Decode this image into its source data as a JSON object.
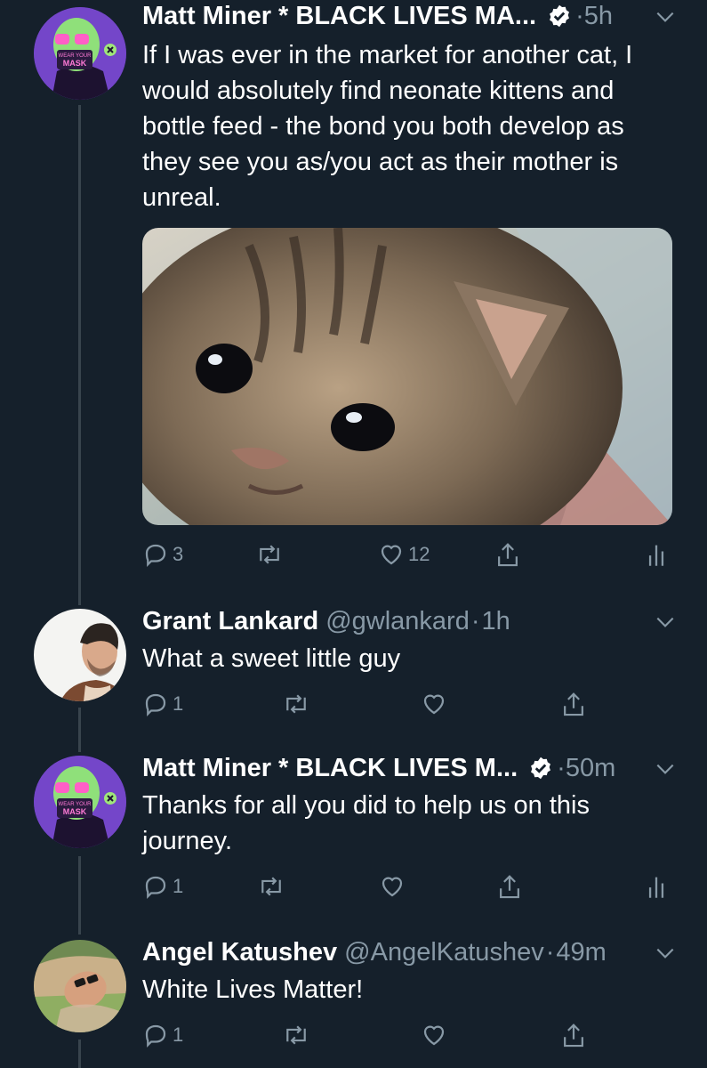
{
  "thread": [
    {
      "name": "Matt Miner * BLACK LIVES MA...",
      "verified": true,
      "dot": "·",
      "time": "5h",
      "text_lines": [
        "If I was ever in the market for another cat, I",
        "would absolutely find neonate kittens and",
        "bottle feed - the bond you both develop as",
        "they see you as/you act as their mother is",
        "unreal."
      ],
      "media_description": "kitten photo",
      "actions": {
        "reply_count": "3",
        "retweet_count": "",
        "like_count": "12"
      }
    },
    {
      "name": "Grant Lankard",
      "handle": "@gwlankard",
      "dot": "·",
      "time": "1h",
      "text_lines": [
        "What a sweet little guy"
      ],
      "actions": {
        "reply_count": "1",
        "retweet_count": "",
        "like_count": ""
      }
    },
    {
      "name": "Matt Miner * BLACK LIVES M...",
      "verified": true,
      "dot": "·",
      "time": "50m",
      "text_lines": [
        "Thanks for all you did to help us on this",
        "journey."
      ],
      "actions": {
        "reply_count": "1",
        "retweet_count": "",
        "like_count": ""
      }
    },
    {
      "name": "Angel Katushev",
      "handle": "@AngelKatushev",
      "dot": "·",
      "time": "49m",
      "text_lines": [
        "White Lives Matter!"
      ],
      "actions": {
        "reply_count": "1",
        "retweet_count": "",
        "like_count": ""
      }
    }
  ],
  "avatar_texts": {
    "mask_top": "WEAR YOUR",
    "mask_bottom": "MASK"
  },
  "colors": {
    "background": "#15202b",
    "secondary_text": "#8899a6",
    "thread_line": "#38444d",
    "primary_text": "#ffffff"
  }
}
